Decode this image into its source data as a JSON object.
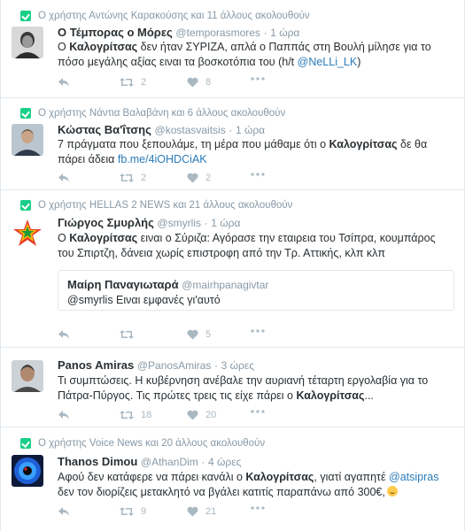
{
  "colors": {
    "link": "#2b7bb9",
    "muted": "#8899a6",
    "action": "#aab8c2",
    "retweet_context": "#19cf86",
    "border": "#e1e8ed"
  },
  "tweets": [
    {
      "context": "Ο χρήστης Αντώνης Καρακούσης και 11 άλλους ακολουθούν",
      "name": "Ο Τέμπορας ο Μόρες",
      "handle": "@temporasmores",
      "time": "1 ώρα",
      "text": {
        "p1": "Ο ",
        "b1": "Καλογρίτσας",
        "p2": " δεν ήταν ΣΥΡΙΖΑ, απλά ο Παππάς στη Βουλή μίλησε για το",
        "p3": "πόσο μεγάλης αξίας ειναι τα βοσκοτόπια του (h/t ",
        "link": "@NeLLi_LK",
        "p4": ")"
      },
      "retweets": "2",
      "likes": "8",
      "avatar_icon": "avatar-portrait-bw"
    },
    {
      "context": "Ο χρήστης Νάντια Βαλαβάνη και 6 άλλους ακολουθούν",
      "name": "Κώστας Βα'ΐτσης",
      "handle": "@kostasvaitsis",
      "time": "1 ώρα",
      "text": {
        "p1": "7 πράγματα που ξεπουλάμε, τη μέρα που μάθαμε ότι ο ",
        "b1": "Καλογρίτσας",
        "p2": " δε θα",
        "p3": "πάρει άδεια ",
        "link": "fb.me/4iOHDCiAK"
      },
      "retweets": "2",
      "likes": "2",
      "avatar_icon": "avatar-portrait"
    },
    {
      "context": "Ο χρήστης HELLAS 2 NEWS και 21 άλλους ακολουθούν",
      "name": "Γιώργος Σμυρλής",
      "handle": "@smyrlis",
      "time": "1 ώρα",
      "text": {
        "p1": "Ο ",
        "b1": "Καλογρίτσας",
        "p2": " ειναι ο Σύριζα: Αγόρασε την εταιρεια του Τσίπρα, κουμπάρος",
        "p3": "του Σπιρτζη, δάνεια χωρίς επιστροφη από την Τρ. Αττικής, κλπ κλπ"
      },
      "quote": {
        "name": "Μαίρη Παναγιωταρά",
        "handle": "@mairhpanagivtar",
        "text": "@smyrlis Ειναι εμφανές γι'αυτό"
      },
      "retweets": "",
      "likes": "5",
      "avatar_icon": "avatar-star-logo"
    },
    {
      "context": "",
      "name": "Panos Amiras",
      "handle": "@PanosAmiras",
      "time": "3 ώρες",
      "text": {
        "p1": "Τι συμπτώσεις. Η κυβέρνηση ανέβαλε την αυριανή τέταρτη εργολαβία για το",
        "p2": "Πάτρα-Πύργος. Τις πρώτες τρεις τις είχε πάρει ο ",
        "b1": "Καλογρίτσας",
        "p3": "..."
      },
      "retweets": "18",
      "likes": "20",
      "avatar_icon": "avatar-portrait"
    },
    {
      "context": "Ο χρήστης Voice News και 20 άλλους ακολουθούν",
      "name": "Thanos Dimou",
      "handle": "@AthanDim",
      "time": "4 ώρες",
      "text": {
        "p1": "Αφού δεν κατάφερε να πάρει κανάλι ο ",
        "b1": "Καλογρίτσας",
        "p2": ", γιατί αγαπητέ ",
        "link": "@atsipras",
        "p3": "δεν τον διορίζεις μετακλητό να βγάλει κατιτίς παραπάνω από 300€,"
      },
      "retweets": "9",
      "likes": "21",
      "avatar_icon": "avatar-eye-logo"
    }
  ]
}
